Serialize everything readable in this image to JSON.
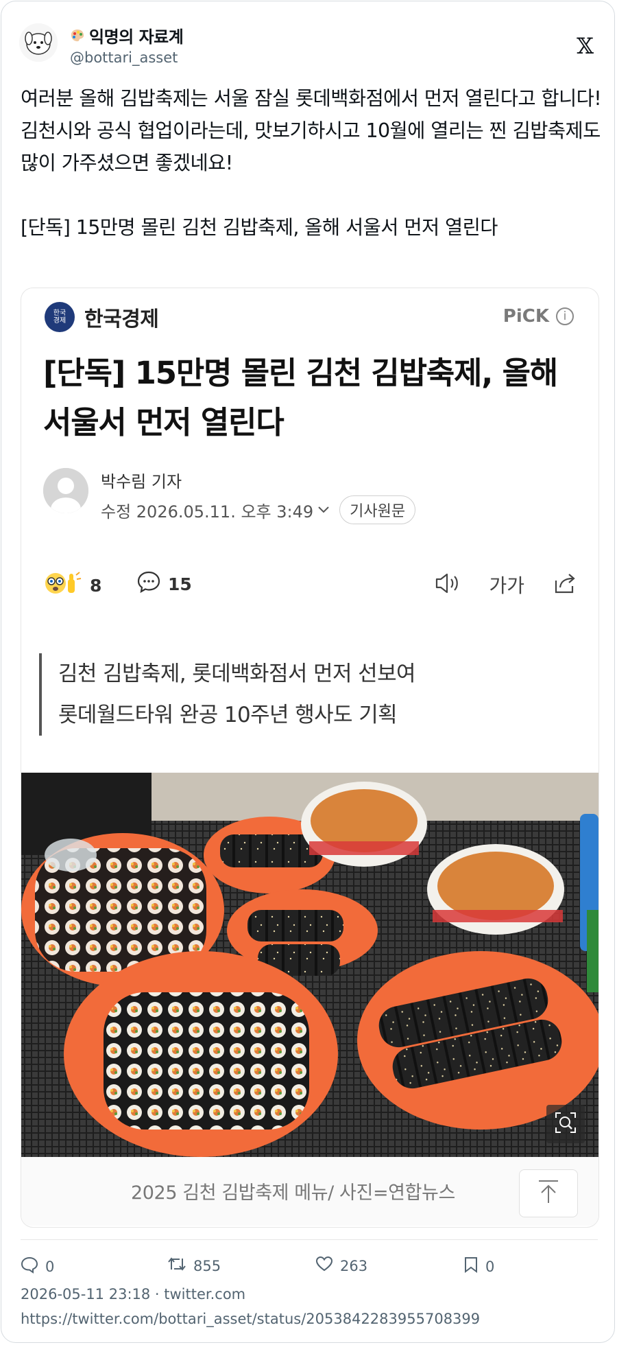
{
  "author": {
    "display_name": "익명의 자료계",
    "handle": "@bottari_asset"
  },
  "tweet": {
    "paragraphs": [
      "여러분 올해 김밥축제는 서울 잠실 롯데백화점에서 먼저 열린다고 합니다!",
      "김천시와 공식 협업이라는데, 맛보기하시고 10월에 열리는 찐 김밥축제도 많이 가주셨으면 좋겠네요!",
      "[단독] 15만명 몰린 김천 김밥축제, 올해 서울서 먼저 열린다"
    ]
  },
  "article": {
    "press_logo_text": "한국\n경제",
    "press_name": "한국경제",
    "pick_label": "PiCK",
    "info_icon_glyph": "i",
    "headline": "[단독] 15만명 몰린 김천 김밥축제, 올해 서울서 먼저 열린다",
    "reporter": "박수림 기자",
    "modified": "수정 2026.05.11. 오후 3:49",
    "original_button": "기사원문",
    "reaction_count": "8",
    "comment_count": "15",
    "font_size_label": "가가",
    "subheads": [
      "김천 김밥축제, 롯데백화점서 먼저 선보여",
      "롯데월드타워 완공 10주년 행사도 기획"
    ],
    "caption": "2025 김천 김밥축제 메뉴/ 사진=연합뉴스"
  },
  "stats": {
    "replies": "0",
    "retweets": "855",
    "likes": "263",
    "bookmarks": "0"
  },
  "footer": {
    "datetime_source": "2026-05-11 23:18 · twitter.com",
    "url": "https://twitter.com/bottari_asset/status/2053842283955708399"
  },
  "colors": {
    "text": "#0f1419",
    "muted": "#536471",
    "press_blue": "#1f3a7a",
    "plate_orange": "#f26b3a"
  }
}
